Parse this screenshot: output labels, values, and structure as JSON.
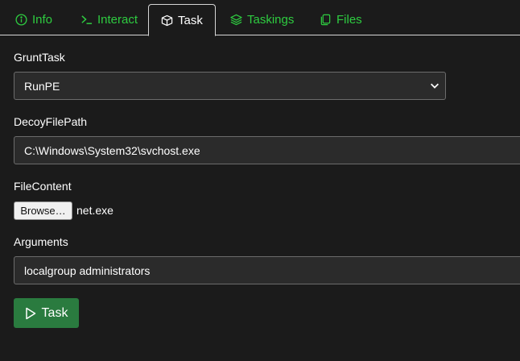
{
  "tabs": [
    {
      "label": "Info",
      "icon": "info-circle-icon"
    },
    {
      "label": "Interact",
      "icon": "terminal-icon"
    },
    {
      "label": "Task",
      "icon": "box-icon"
    },
    {
      "label": "Taskings",
      "icon": "layers-icon"
    },
    {
      "label": "Files",
      "icon": "files-icon"
    }
  ],
  "active_tab": "Task",
  "form": {
    "grunt_task_label": "GruntTask",
    "grunt_task_value": "RunPE",
    "decoy_label": "DecoyFilePath",
    "decoy_value": "C:\\Windows\\System32\\svchost.exe",
    "file_content_label": "FileContent",
    "browse_label": "Browse…",
    "file_name": "net.exe",
    "arguments_label": "Arguments",
    "arguments_value": "localgroup administrators",
    "submit_label": "Task"
  },
  "colors": {
    "accent_green": "#2ecc40",
    "button_green": "#2a7b3f",
    "background": "#1b1b1b"
  }
}
